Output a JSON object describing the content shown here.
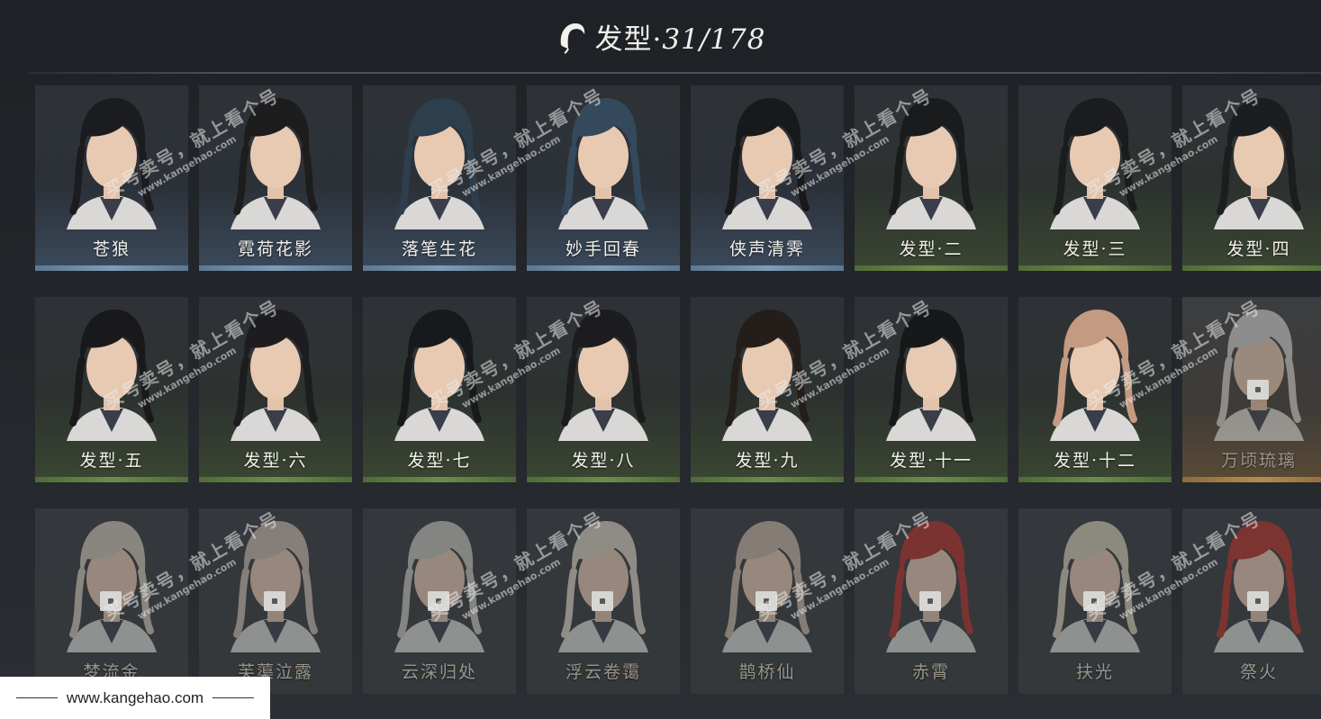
{
  "header": {
    "title": "发型·",
    "count": "31/178",
    "icon": "hair-icon"
  },
  "colors": {
    "blue_rarity": "#7f9db6",
    "green_rarity": "#6e8c48",
    "orange_rarity": "#b68c4d"
  },
  "rows": [
    [
      {
        "name": "苍狼",
        "tier": "blue",
        "hair": "#1b1c1f"
      },
      {
        "name": "霓荷花影",
        "tier": "blue",
        "hair": "#1d1d1e"
      },
      {
        "name": "落笔生花",
        "tier": "blue",
        "hair": "#2d3e4d"
      },
      {
        "name": "妙手回春",
        "tier": "blue",
        "hair": "#34495b"
      },
      {
        "name": "侠声清霁",
        "tier": "blue",
        "hair": "#18191b"
      },
      {
        "name": "发型·二",
        "tier": "green",
        "hair": "#1a1b1d"
      },
      {
        "name": "发型·三",
        "tier": "green",
        "hair": "#1b1c1e"
      },
      {
        "name": "发型·四",
        "tier": "green",
        "hair": "#1c1d1f"
      }
    ],
    [
      {
        "name": "发型·五",
        "tier": "green",
        "hair": "#19191b"
      },
      {
        "name": "发型·六",
        "tier": "green",
        "hair": "#1d1d1f"
      },
      {
        "name": "发型·七",
        "tier": "green",
        "hair": "#18191c"
      },
      {
        "name": "发型·八",
        "tier": "green",
        "hair": "#1c1c1e"
      },
      {
        "name": "发型·九",
        "tier": "green",
        "hair": "#241d1a"
      },
      {
        "name": "发型·十一",
        "tier": "green",
        "hair": "#17181a"
      },
      {
        "name": "发型·十二",
        "tier": "green",
        "hair": "#c49a82"
      },
      {
        "name": "万顷琉璃",
        "tier": "orange",
        "hair": "#cfcfcd"
      }
    ],
    [
      {
        "name": "梦流金",
        "tier": "locked",
        "hair": "#cfc6b7"
      },
      {
        "name": "芙蕖泣露",
        "tier": "locked",
        "hair": "#c9b8ad"
      },
      {
        "name": "云深归处",
        "tier": "locked",
        "hair": "#c7c4bd"
      },
      {
        "name": "浮云卷霭",
        "tier": "locked",
        "hair": "#d9d3c3"
      },
      {
        "name": "鹊桥仙",
        "tier": "locked",
        "hair": "#c7b6a5"
      },
      {
        "name": "赤霄",
        "tier": "locked",
        "hair": "#b5302a"
      },
      {
        "name": "扶光",
        "tier": "locked",
        "hair": "#d5cdb6"
      },
      {
        "name": "祭火",
        "tier": "locked",
        "hair": "#b83229"
      }
    ]
  ],
  "watermark": {
    "text": "买号卖号，就上看个号",
    "url": "www.kangehao.com"
  },
  "footer": {
    "url": "www.kangehao.com"
  }
}
